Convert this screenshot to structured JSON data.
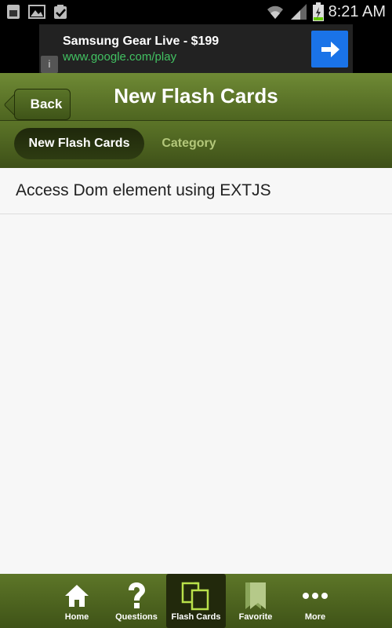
{
  "status_bar": {
    "time": "8:21 AM",
    "left_icons": [
      "sim-icon",
      "image-icon",
      "clipboard-check-icon"
    ],
    "right_icons": [
      "wifi-icon",
      "signal-icon",
      "battery-charging-icon"
    ]
  },
  "ad": {
    "title": "Samsung Gear Live - $199",
    "url": "www.google.com/play",
    "info": "i"
  },
  "header": {
    "back_label": "Back",
    "title": "New Flash Cards"
  },
  "segments": {
    "active": "New Flash Cards",
    "inactive": "Category"
  },
  "list": {
    "items": [
      "Access Dom element using EXTJS"
    ]
  },
  "tabbar": {
    "tabs": [
      {
        "label": "Home",
        "icon": "home-icon"
      },
      {
        "label": "Questions",
        "icon": "question-icon"
      },
      {
        "label": "Flash Cards",
        "icon": "flash-cards-icon",
        "active": true
      },
      {
        "label": "Favorite",
        "icon": "bookmark-icon"
      },
      {
        "label": "More",
        "icon": "more-icon"
      }
    ]
  },
  "colors": {
    "bar_green": "#5d7628",
    "ad_url_green": "#42c262",
    "ad_button_blue": "#1a73e8",
    "active_tab_icon": "#b8e04a"
  }
}
